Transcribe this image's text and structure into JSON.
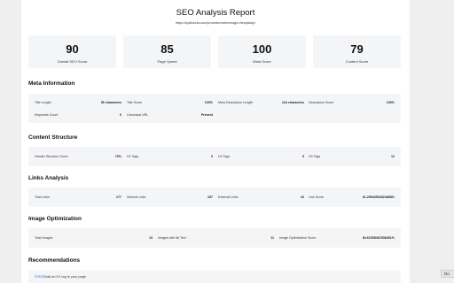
{
  "report": {
    "title": "SEO Analysis Report",
    "url": "https://nyclicecbc.com/procedures/beverage-rhinoplasty/"
  },
  "scores": [
    {
      "value": "90",
      "label": "Overall SEO Score"
    },
    {
      "value": "85",
      "label": "Page Speed"
    },
    {
      "value": "100",
      "label": "Meta Score"
    },
    {
      "value": "79",
      "label": "Content Score"
    }
  ],
  "meta_information": {
    "title": "Meta Information",
    "rows": [
      {
        "key": "Title Length",
        "value": "56 characters"
      },
      {
        "key": "Title Score",
        "value": "100%"
      },
      {
        "key": "Meta Description Length",
        "value": "144 characters"
      },
      {
        "key": "Description Score",
        "value": "100%"
      },
      {
        "key": "Keywords Count",
        "value": "0"
      },
      {
        "key": "Canonical URL",
        "value": "Present"
      }
    ]
  },
  "content_structure": {
    "title": "Content Structure",
    "rows": [
      {
        "key": "Header Structure Score",
        "value": "70%"
      },
      {
        "key": "H1 Tags",
        "value": "0"
      },
      {
        "key": "H2 Tags",
        "value": "9"
      },
      {
        "key": "H3 Tags",
        "value": "12"
      }
    ]
  },
  "links_analysis": {
    "title": "Links Analysis",
    "rows": [
      {
        "key": "Total Links",
        "value": "177"
      },
      {
        "key": "Internal Links",
        "value": "157"
      },
      {
        "key": "External Links",
        "value": "20"
      },
      {
        "key": "Link Score",
        "value": "61.29943502824858%"
      }
    ]
  },
  "image_optimization": {
    "title": "Image Optimization",
    "rows": [
      {
        "key": "Total Images",
        "value": "13"
      },
      {
        "key": "Images with Alt Text",
        "value": "11"
      },
      {
        "key": "Image Optimization Score",
        "value": "84.61538461538461%"
      }
    ]
  },
  "recommendations": {
    "title": "Recommendations",
    "badge": "ISSUE",
    "item": "Add an H1 tag to your page"
  },
  "corner_button": "Do"
}
